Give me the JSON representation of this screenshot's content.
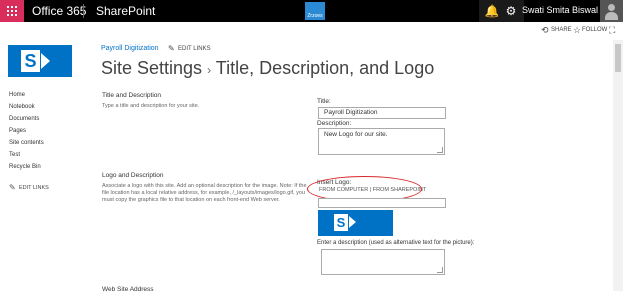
{
  "suitebar": {
    "brand": "Office 365",
    "product": "SharePoint",
    "app_logo_text": "Zrzoes",
    "bell_glyph": "🔔",
    "gear_glyph": "⚙",
    "help_glyph": "?",
    "user_name": "Swati Smita Biswal"
  },
  "actions": {
    "share": "SHARE",
    "follow": "FOLLOW",
    "share_glyph": "⟲",
    "follow_glyph": "☆",
    "focus_glyph": "⛶"
  },
  "header": {
    "site_name": "Payroll Digitization",
    "edit_links": "EDIT LINKS",
    "pencil_glyph": "✎",
    "title": "Site Settings",
    "title_sep": "›",
    "subtitle": "Title, Description, and Logo"
  },
  "nav": {
    "items": [
      "Home",
      "Notebook",
      "Documents",
      "Pages",
      "Site contents",
      "Test",
      "Recycle Bin"
    ],
    "edit_links": "EDIT LINKS"
  },
  "title_section": {
    "heading": "Title and Description",
    "desc": "Type a title and description for your site.",
    "title_label": "Title:",
    "title_value": "Payroll Digitization",
    "description_label": "Description:",
    "description_value": "New Logo for our site."
  },
  "logo_section": {
    "heading": "Logo and Description",
    "desc": "Associate a logo with this site. Add an optional description for the image. Note: If the file location has a local relative address, for example, /_layouts/images/logo.gif, you must copy the graphics file to that location on each front-end Web server.",
    "insert_label": "Insert Logo:",
    "from_computer": "FROM COMPUTER",
    "link_sep": "|",
    "from_sharepoint": "FROM SHAREPOINT",
    "alt_label": "Enter a description (used as alternative text for the picture):"
  },
  "next_section": {
    "heading": "Web Site Address"
  },
  "colors": {
    "suitebar": "#000000",
    "waffle": "#d92e5c",
    "link": "#0072c6",
    "annotation": "#d7262a"
  }
}
